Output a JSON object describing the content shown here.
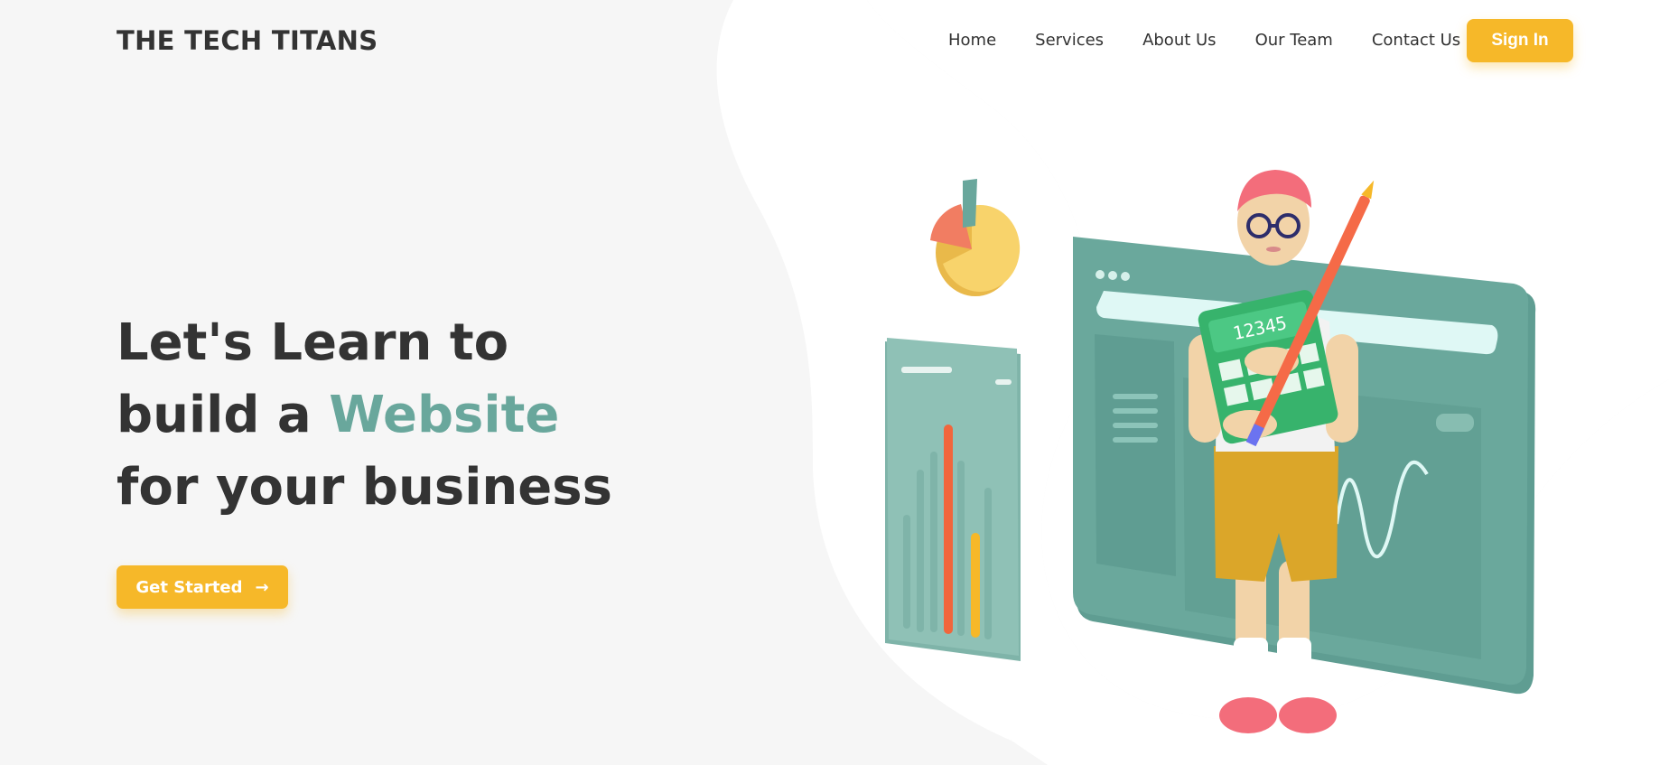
{
  "brand": {
    "name": "THE TECH TITANS"
  },
  "nav": {
    "items": [
      {
        "label": "Home"
      },
      {
        "label": "Services"
      },
      {
        "label": "About Us"
      },
      {
        "label": "Our Team"
      },
      {
        "label": "Contact Us"
      }
    ],
    "signin_label": "Sign In"
  },
  "hero": {
    "line1": "Let's Learn to",
    "line2_prefix": "build a ",
    "line2_accent": "Website",
    "line3": "for your business",
    "cta_label": "Get Started",
    "cta_icon": "arrow-right-icon"
  },
  "illustration": {
    "calculator_text": "12345"
  },
  "colors": {
    "accent_yellow": "#f6b829",
    "accent_teal": "#69a79c",
    "text_dark": "#333333",
    "background": "#f6f6f6"
  }
}
